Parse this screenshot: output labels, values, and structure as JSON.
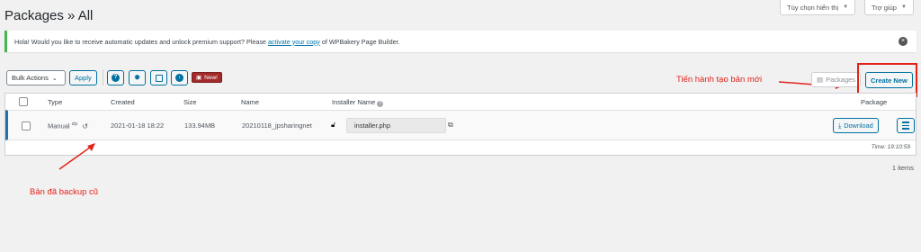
{
  "header": {
    "title": "Packages » All",
    "screen_options": "Tùy chọn hiển thị",
    "help": "Trợ giúp"
  },
  "notice": {
    "text_before": "Hola! Would you like to receive automatic updates and unlock premium support? Please",
    "link": "activate your copy",
    "text_after": "of WPBakery Page Builder."
  },
  "toolbar": {
    "bulk_actions": "Bulk Actions",
    "apply": "Apply",
    "new_badge": "New!",
    "packages_tab": "Packages",
    "create_new": "Create New"
  },
  "table": {
    "columns": {
      "type": "Type",
      "created": "Created",
      "size": "Size",
      "name": "Name",
      "installer_name": "Installer Name",
      "package": "Package"
    },
    "rows": [
      {
        "type": "Manual",
        "type_sup": "zip",
        "created": "2021-01-18 18:22",
        "size": "133.94MB",
        "name": "20210118_jpsharingnet",
        "installer": "installer.php",
        "download": "Download"
      }
    ],
    "time": "Time: 19:10:59",
    "count": "1 items"
  },
  "annotations": {
    "create_note": "Tiến hành tạo bản mới",
    "backup_note": "Bản đã backup cũ",
    "color": "#e2231a"
  }
}
